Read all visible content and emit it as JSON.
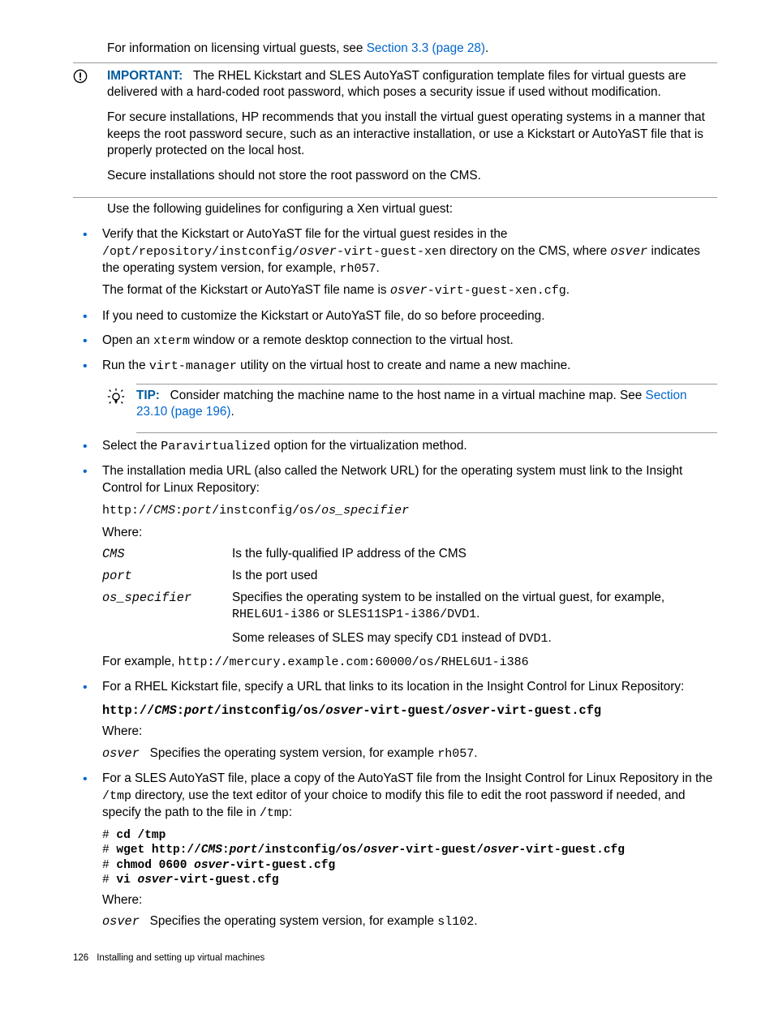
{
  "intro": {
    "pre": "For information on licensing virtual guests, see ",
    "link": "Section 3.3 (page 28)",
    "post": "."
  },
  "important": {
    "label": "IMPORTANT:",
    "p1": "The RHEL Kickstart and SLES AutoYaST configuration template files for virtual guests are delivered with a hard-coded root password, which poses a security issue if used without modification.",
    "p2": "For secure installations, HP recommends that you install the virtual guest operating systems in a manner that keeps the root password secure, such as an interactive installation, or use a Kickstart or AutoYaST file that is properly protected on the local host.",
    "p3": "Secure installations should not store the root password on the CMS."
  },
  "guidelines_intro": "Use the following guidelines for configuring a Xen virtual guest:",
  "b1": {
    "pre1": "Verify that the Kickstart or AutoYaST file for the virtual guest resides in the ",
    "code1": "/opt/repository/instconfig/",
    "code1_i": "osver",
    "code1b": "-virt-guest-xen",
    "post1": " directory on the CMS, where ",
    "code2_i": "osver",
    "post2": " indicates the operating system version, for example, ",
    "code3": "rh057",
    "post3": ".",
    "line2_pre": "The format of the Kickstart or AutoYaST file name is ",
    "line2_i": "osver",
    "line2_code": "-virt-guest-xen.cfg",
    "line2_post": "."
  },
  "b2": "If you need to customize the Kickstart or AutoYaST file, do so before proceeding.",
  "b3": {
    "pre": "Open an ",
    "code": "xterm",
    "post": " window or a remote desktop connection to the virtual host."
  },
  "b4": {
    "pre": "Run the ",
    "code": "virt-manager",
    "post": " utility on the virtual host to create and name a new machine."
  },
  "tip": {
    "label": "TIP:",
    "text": "Consider matching the machine name to the host name in a virtual machine map. See ",
    "link": "Section 23.10 (page 196)",
    "post": "."
  },
  "b5": {
    "pre": "Select the ",
    "code": "Paravirtualized",
    "post": " option for the virtualization method."
  },
  "b6": {
    "p1": "The installation media URL (also called the Network URL) for the operating system must link to the Insight Control for Linux Repository:",
    "url_pre": "http://",
    "url_cms": "CMS",
    "url_colon": ":",
    "url_port": "port",
    "url_mid": "/instconfig/os/",
    "url_spec": "os_specifier",
    "where": "Where:",
    "t_cms": "CMS",
    "d_cms": "Is the fully-qualified IP address of the CMS",
    "t_port": "port",
    "d_port": "Is the port used",
    "t_spec": "os_specifier",
    "d_spec_pre": "Specifies the operating system to be installed on the virtual guest, for example, ",
    "d_spec_c1": "RHEL6U1-i386",
    "d_spec_or": " or ",
    "d_spec_c2": "SLES11SP1-i386/DVD1",
    "d_spec_post": ".",
    "d_spec2_pre": "Some releases of SLES may specify ",
    "d_spec2_c1": "CD1",
    "d_spec2_mid": " instead of ",
    "d_spec2_c2": "DVD1",
    "d_spec2_post": ".",
    "example_pre": "For example, ",
    "example_code": "http://mercury.example.com:60000/os/RHEL6U1-i386"
  },
  "b7": {
    "p1": "For a RHEL Kickstart file, specify a URL that links to its location in the Insight Control for Linux Repository:",
    "url_a": "http://",
    "url_cms": "CMS",
    "url_colon": ":",
    "url_port": "port",
    "url_b": "/instconfig/os/",
    "url_osv1": "osver",
    "url_c": "-virt-guest/",
    "url_osv2": "osver",
    "url_d": "-virt-guest.cfg",
    "where": "Where:",
    "t_osver": "osver",
    "d_pre": "Specifies the operating system version, for example ",
    "d_code": "rh057",
    "d_post": "."
  },
  "b8": {
    "p1_pre": "For a SLES AutoYaST file, place a copy of the AutoYaST file from the Insight Control for Linux Repository in the ",
    "p1_c1": "/tmp",
    "p1_mid": " directory, use the text editor of your choice to modify this file to edit the root password if needed, and specify the path to the file in ",
    "p1_c2": "/tmp",
    "p1_post": ":",
    "l1a": "# ",
    "l1b": "cd /tmp",
    "l2a": "# ",
    "l2b": "wget http://",
    "l2c": "CMS",
    "l2d": ":",
    "l2e": "port",
    "l2f": "/instconfig/os/",
    "l2g": "osver",
    "l2h": "-virt-guest/",
    "l2i": "osver",
    "l2j": "-virt-guest.cfg",
    "l3a": "# ",
    "l3b": "chmod 0600 ",
    "l3c": "osver",
    "l3d": "-virt-guest.cfg",
    "l4a": "# ",
    "l4b": "vi ",
    "l4c": "osver",
    "l4d": "-virt-guest.cfg",
    "where": "Where:",
    "t_osver": "osver",
    "d_pre": "Specifies the operating system version, for example ",
    "d_code": "sl102",
    "d_post": "."
  },
  "footer": {
    "page": "126",
    "title": "Installing and setting up virtual machines"
  }
}
